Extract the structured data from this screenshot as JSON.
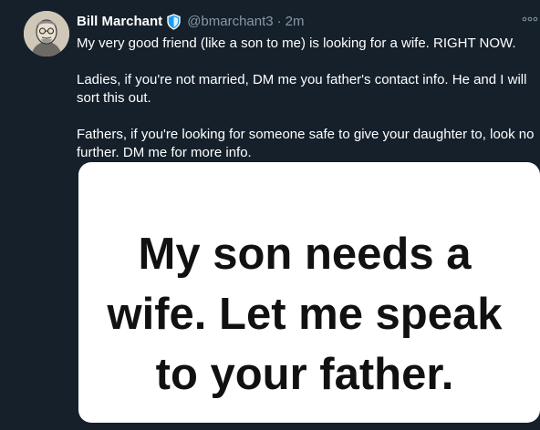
{
  "tweet": {
    "author_name": "Bill Marchant",
    "handle": "@bmarchant3",
    "separator": "·",
    "time": "2m",
    "more_icon": "more-options-icon",
    "badge_icon": "shield-badge-icon",
    "paragraphs": [
      "My very good friend (like a son to me) is looking for a wife. RIGHT NOW.",
      "Ladies, if you're not married, DM me you father's contact info. He and I will\nsort this out.",
      "Fathers, if you're looking for someone safe to give your daughter to, look no\nfurther. DM me for more info."
    ],
    "media_text": "My son needs a\nwife. Let me speak\nto your father."
  },
  "colors": {
    "background": "#15202b",
    "secondary_text": "#8899a6",
    "badge_blue": "#1d9bf0"
  }
}
